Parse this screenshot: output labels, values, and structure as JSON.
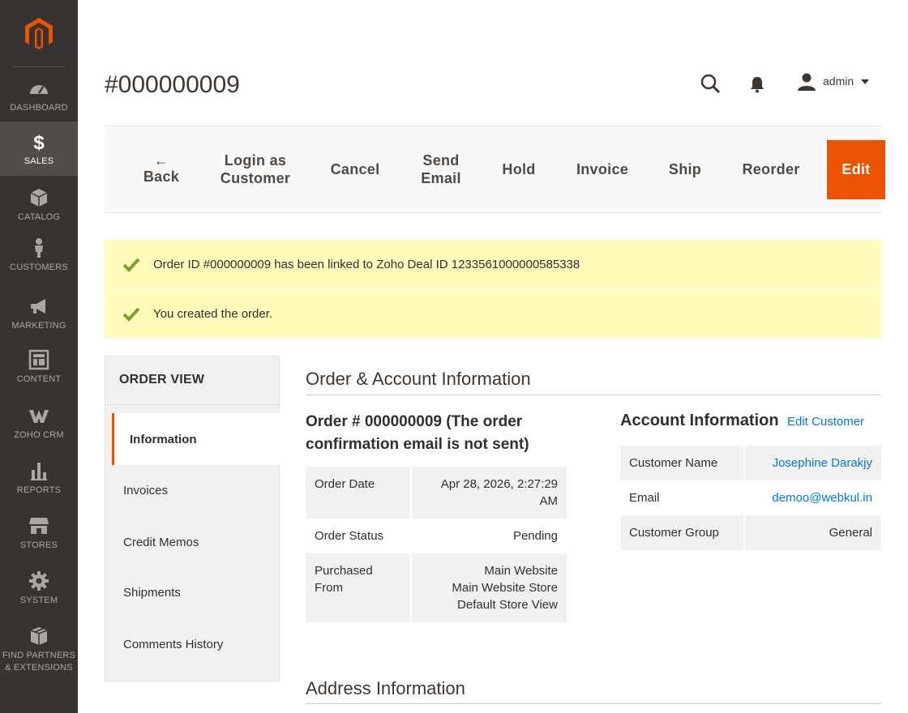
{
  "sidebar": {
    "logo": "magento-logo",
    "items": [
      {
        "label": "DASHBOARD",
        "icon": "dashboard-icon"
      },
      {
        "label": "SALES",
        "icon": "dollar-icon",
        "active": true
      },
      {
        "label": "CATALOG",
        "icon": "cube-icon"
      },
      {
        "label": "CUSTOMERS",
        "icon": "person-icon"
      },
      {
        "label": "MARKETING",
        "icon": "megaphone-icon"
      },
      {
        "label": "CONTENT",
        "icon": "layout-icon"
      },
      {
        "label": "ZOHO CRM",
        "icon": "zoho-icon"
      },
      {
        "label": "REPORTS",
        "icon": "bar-chart-icon"
      },
      {
        "label": "STORES",
        "icon": "store-icon"
      },
      {
        "label": "SYSTEM",
        "icon": "gear-icon"
      },
      {
        "label": "FIND PARTNERS\n& EXTENSIONS",
        "line1": "FIND PARTNERS",
        "line2": "& EXTENSIONS",
        "icon": "box-icon"
      }
    ]
  },
  "header": {
    "title": "#000000009",
    "user": "admin"
  },
  "actions": {
    "back": "Back",
    "login_line1": "Login as",
    "login_line2": "Customer",
    "cancel": "Cancel",
    "send_line1": "Send",
    "send_line2": "Email",
    "hold": "Hold",
    "invoice": "Invoice",
    "ship": "Ship",
    "reorder": "Reorder",
    "edit": "Edit"
  },
  "messages": [
    "Order ID #000000009 has been linked to Zoho Deal ID 1233561000000585338",
    "You created the order."
  ],
  "tabs": {
    "title": "ORDER VIEW",
    "items": [
      "Information",
      "Invoices",
      "Credit Memos",
      "Shipments",
      "Comments History"
    ]
  },
  "main": {
    "section1_title": "Order & Account Information",
    "order_heading": "Order # 000000009 (The order confirmation email is not sent)",
    "order_rows": [
      {
        "key": "Order Date",
        "value": "Apr 28, 2026, 2:27:29 AM"
      },
      {
        "key": "Order Status",
        "value": "Pending"
      },
      {
        "key": "Purchased From",
        "value_lines": [
          "Main Website",
          "Main Website Store",
          "Default Store View"
        ]
      }
    ],
    "account_title": "Account Information",
    "edit_customer": "Edit Customer",
    "account_rows": [
      {
        "key": "Customer Name",
        "value": "Josephine Darakjy"
      },
      {
        "key": "Email",
        "value": "demoo@webkul.in"
      },
      {
        "key": "Customer Group",
        "value": "General"
      }
    ],
    "section2_title": "Address Information"
  },
  "colors": {
    "sidebar_bg": "#373330",
    "accent": "#eb5202",
    "link": "#007bdb",
    "message_bg": "#fffbbb",
    "check": "#79a22e"
  }
}
